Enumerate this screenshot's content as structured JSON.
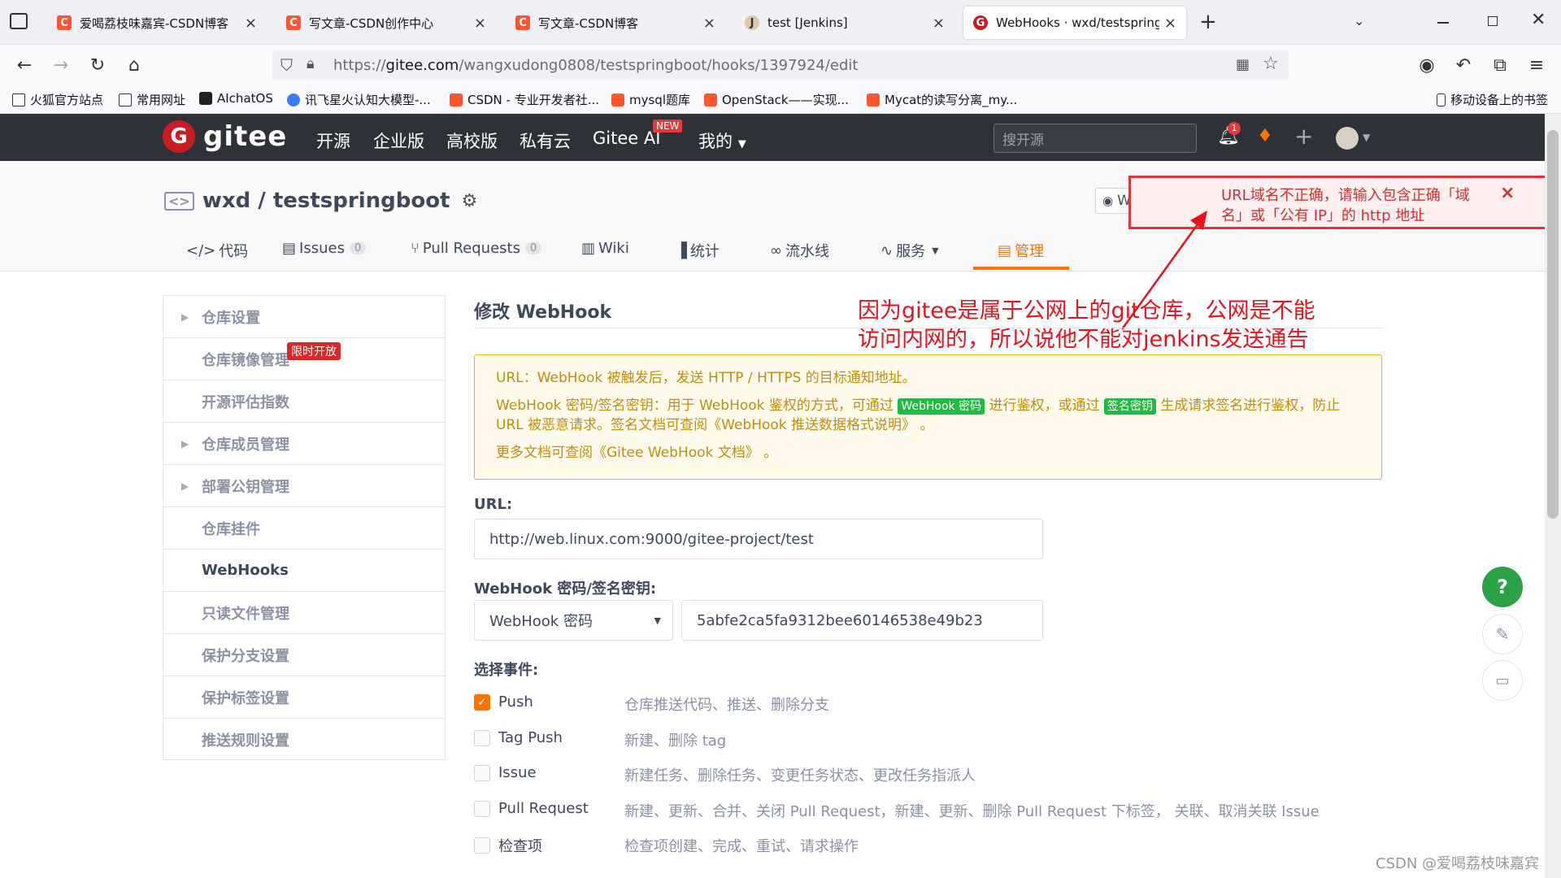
{
  "browser": {
    "tabs": [
      {
        "title": "爱喝荔枝味嘉宾-CSDN博客",
        "icon": "csdn-icon"
      },
      {
        "title": "写文章-CSDN创作中心",
        "icon": "csdn-icon"
      },
      {
        "title": "写文章-CSDN博客",
        "icon": "csdn-icon"
      },
      {
        "title": "test [Jenkins]",
        "icon": "jenkins-icon"
      },
      {
        "title": "WebHooks · wxd/testspringb",
        "icon": "gitee-icon"
      }
    ],
    "new_tab": "+",
    "url_prefix": "https://",
    "url_host": "gitee.com",
    "url_path": "/wangxudong0808/testspringboot/hooks/1397924/edit",
    "bookmarks": [
      "火狐官方站点",
      "常用网址",
      "AIchatOS",
      "讯飞星火认知大模型-...",
      "CSDN - 专业开发者社...",
      "mysql题库",
      "OpenStack——实现...",
      "Mycat的读写分离_my..."
    ],
    "mobile_bookmarks": "移动设备上的书签"
  },
  "gitee": {
    "brand": "gitee",
    "nav": [
      "开源",
      "企业版",
      "高校版",
      "私有云",
      "Gitee AI",
      "我的"
    ],
    "new_badge": "NEW",
    "search_placeholder": "搜开源",
    "notif_count": "1",
    "repo_title": "wxd / testspringboot",
    "watch_label": "Watching",
    "repo_tabs": [
      {
        "label": "代码"
      },
      {
        "label": "Issues",
        "count": "0"
      },
      {
        "label": "Pull Requests",
        "count": "0"
      },
      {
        "label": "Wiki"
      },
      {
        "label": "统计"
      },
      {
        "label": "流水线"
      },
      {
        "label": "服务"
      },
      {
        "label": "管理"
      }
    ]
  },
  "toast": {
    "message": "URL域名不正确，请输入包含正确「域名」或「公有 IP」的 http 地址",
    "close": "×"
  },
  "annotation": "因为gitee是属于公网上的git仓库，公网是不能访问内网的，所以说他不能对jenkins发送通告",
  "sidebar": {
    "items": [
      "仓库设置",
      "仓库镜像管理",
      "开源评估指数",
      "仓库成员管理",
      "部署公钥管理",
      "仓库挂件",
      "WebHooks",
      "只读文件管理",
      "保护分支设置",
      "保护标签设置",
      "推送规则设置"
    ],
    "limited_badge": "限时开放"
  },
  "form": {
    "title": "修改 WebHook",
    "info_line1": "URL：WebHook 被触发后，发送 HTTP / HTTPS 的目标通知地址。",
    "info_line2_a": "WebHook 密码/签名密钥：用于 WebHook 鉴权的方式，可通过",
    "info_tag1": "WebHook 密码",
    "info_line2_b": "进行鉴权，或通过",
    "info_tag2": "签名密钥",
    "info_line2_c": "生成请求签名进行鉴权，防止 URL 被恶意请求。签名文档可查阅",
    "info_link1": "《WebHook 推送数据格式说明》",
    "info_line3_a": "更多文档可查阅",
    "info_link2": "《Gitee WebHook 文档》",
    "period": "。",
    "url_label": "URL:",
    "url_value": "http://web.linux.com:9000/gitee-project/test",
    "secret_label": "WebHook 密码/签名密钥:",
    "secret_type": "WebHook 密码",
    "secret_value": "5abfe2ca5fa9312bee60146538e49b23",
    "events_label": "选择事件:",
    "events": [
      {
        "name": "Push",
        "desc": "仓库推送代码、推送、删除分支",
        "checked": true
      },
      {
        "name": "Tag Push",
        "desc": "新建、删除 tag",
        "checked": false
      },
      {
        "name": "Issue",
        "desc": "新建任务、删除任务、变更任务状态、更改任务指派人",
        "checked": false
      },
      {
        "name": "Pull Request",
        "desc": "新建、更新、合并、关闭 Pull Request，新建、更新、删除 Pull Request 下标签， 关联、取消关联 Issue",
        "checked": false
      },
      {
        "name": "检查项",
        "desc": "检查项创建、完成、重试、请求操作",
        "checked": false
      }
    ]
  },
  "help_button": "?",
  "watermark": "CSDN @爱喝荔枝味嘉宾"
}
